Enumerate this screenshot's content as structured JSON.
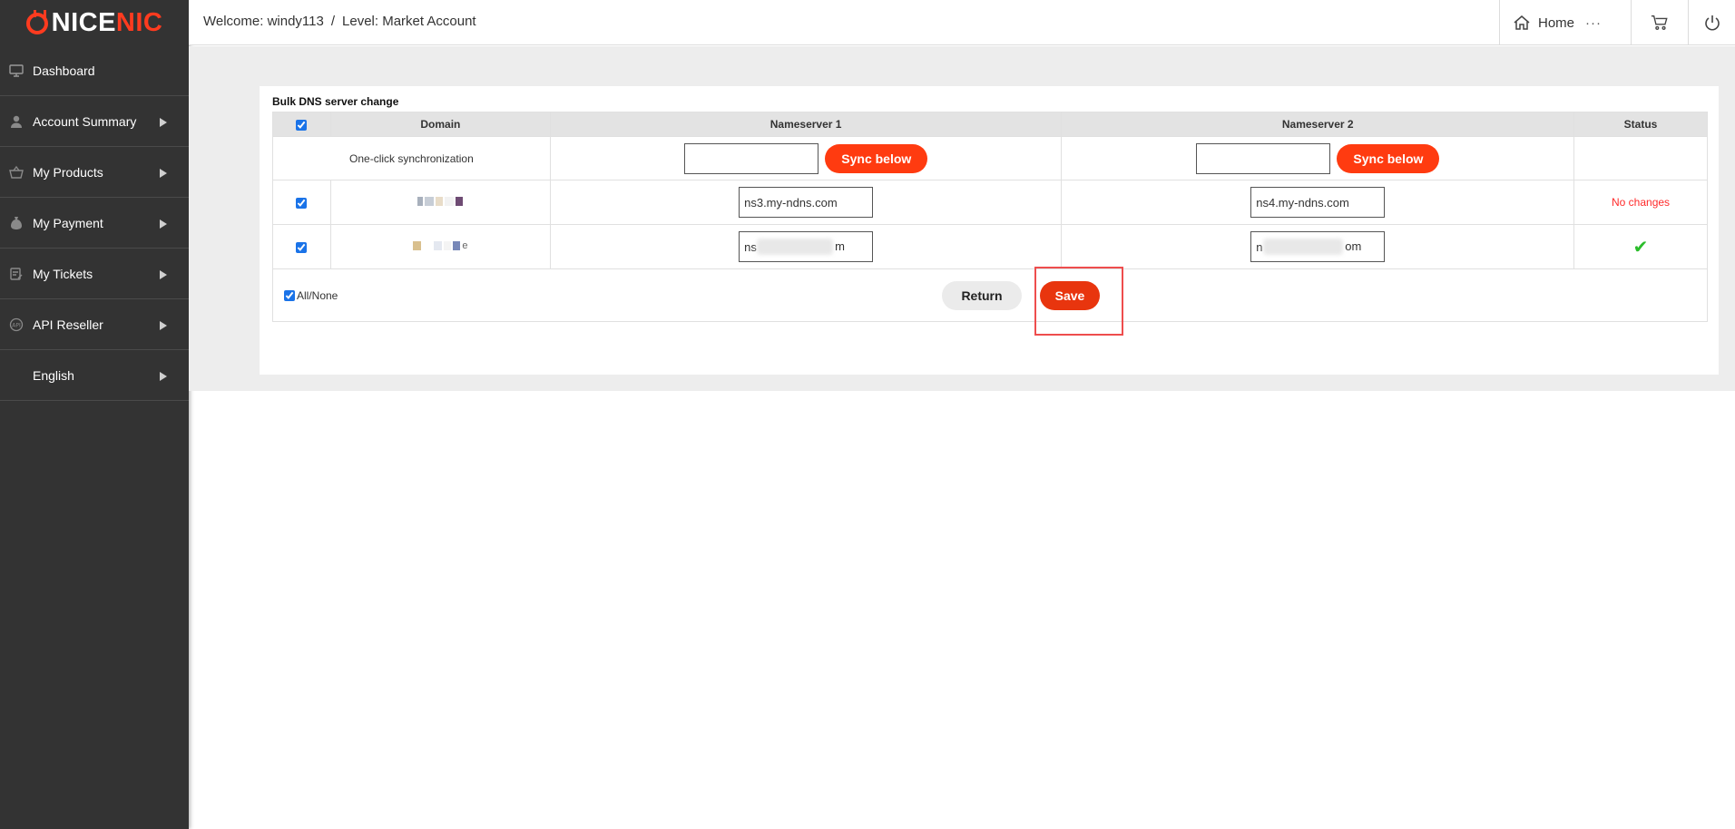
{
  "brand": {
    "logo_left": "NICE",
    "logo_right": "NIC",
    "accent": "#ff3b1f"
  },
  "sidebar": {
    "items": [
      {
        "label": "Dashboard",
        "icon": "monitor-icon",
        "has_arrow": false
      },
      {
        "label": "Account Summary",
        "icon": "user-icon",
        "has_arrow": true
      },
      {
        "label": "My Products",
        "icon": "basket-icon",
        "has_arrow": true
      },
      {
        "label": "My Payment",
        "icon": "money-bag-icon",
        "has_arrow": true
      },
      {
        "label": "My Tickets",
        "icon": "ticket-icon",
        "has_arrow": true
      },
      {
        "label": "API Reseller",
        "icon": "api-icon",
        "has_arrow": true
      },
      {
        "label": "English",
        "icon": "",
        "has_arrow": true
      }
    ]
  },
  "header": {
    "welcome": "Welcome: windy113",
    "separator": "/",
    "level": "Level: Market Account",
    "home_label": "Home",
    "dots": "···"
  },
  "panel": {
    "title": "Bulk DNS server change",
    "columns": {
      "domain": "Domain",
      "ns1": "Nameserver 1",
      "ns2": "Nameserver 2",
      "status": "Status"
    },
    "sync_row": {
      "label": "One-click synchronization",
      "sync_button": "Sync below"
    },
    "rows": [
      {
        "ns1": "ns3.my-ndns.com",
        "ns2": "ns4.my-ndns.com",
        "status": "No changes"
      },
      {
        "ns1": "ns",
        "ns1_tail": "m",
        "ns2": "n",
        "ns2_tail": "om",
        "status": "✔"
      }
    ],
    "footer": {
      "all_none": "All/None",
      "return_label": "Return",
      "save_label": "Save"
    }
  }
}
